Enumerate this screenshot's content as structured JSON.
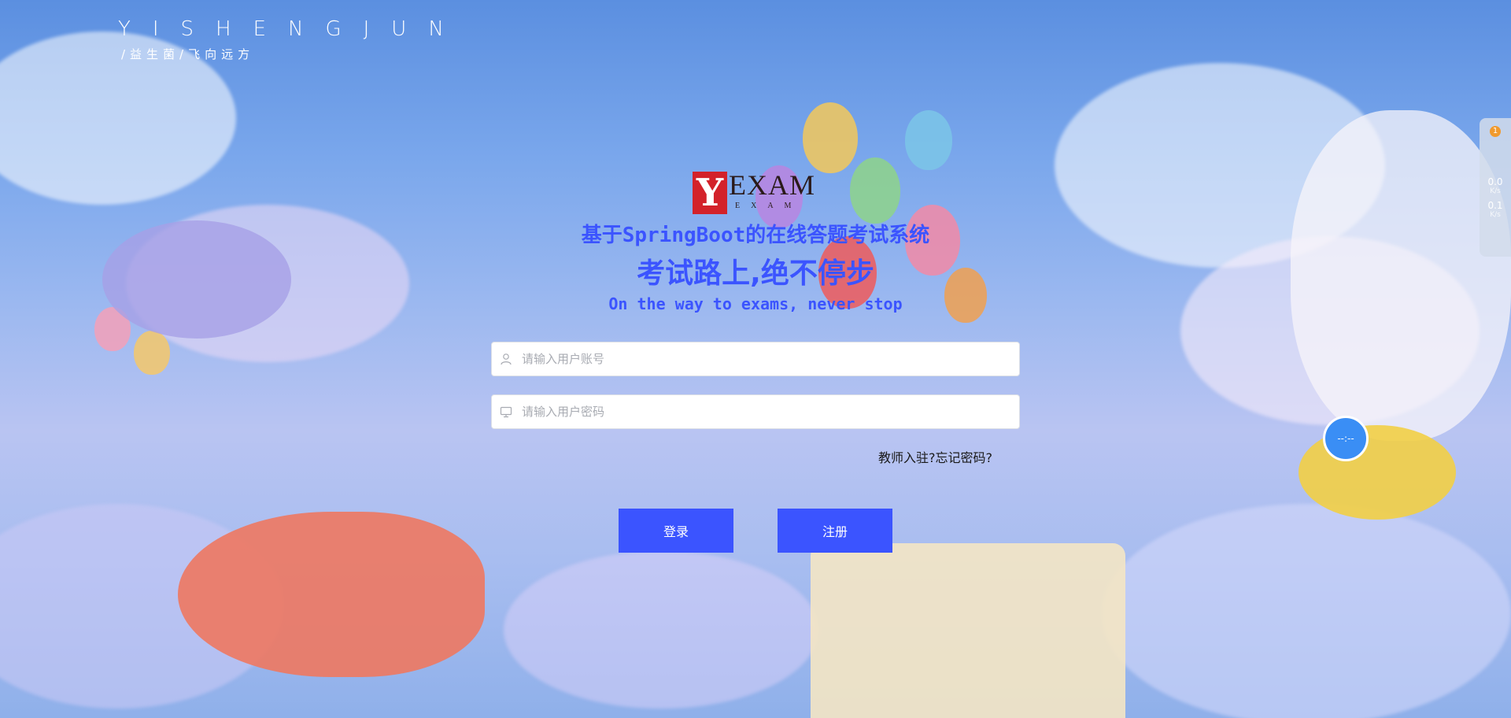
{
  "brand": {
    "title": "YISHENGJUN",
    "subtitle": "/益生菌/飞向远方"
  },
  "logo": {
    "mark": "Y",
    "word": "EXAM",
    "small": "EXAM"
  },
  "system_title": "基于SpringBoot的在线答题考试系统",
  "slogan": "考试路上,绝不停步",
  "slogan_en": "On the way to exams, never stop",
  "login_form": {
    "username_placeholder": "请输入用户账号",
    "password_placeholder": "请输入用户密码",
    "teacher_link": "教师入驻?",
    "forgot_link": "忘记密码?",
    "login_label": "登录",
    "register_label": "注册"
  },
  "net_widget": {
    "badge": "1",
    "down_value": "0.0",
    "down_unit": "K/s",
    "up_value": "0.1",
    "up_unit": "K/s"
  },
  "floating_ball": {
    "label": "--:--"
  },
  "colors": {
    "accent": "#3b54ff",
    "logo_red": "#d3222a",
    "ball_blue": "#3a8ef5"
  }
}
